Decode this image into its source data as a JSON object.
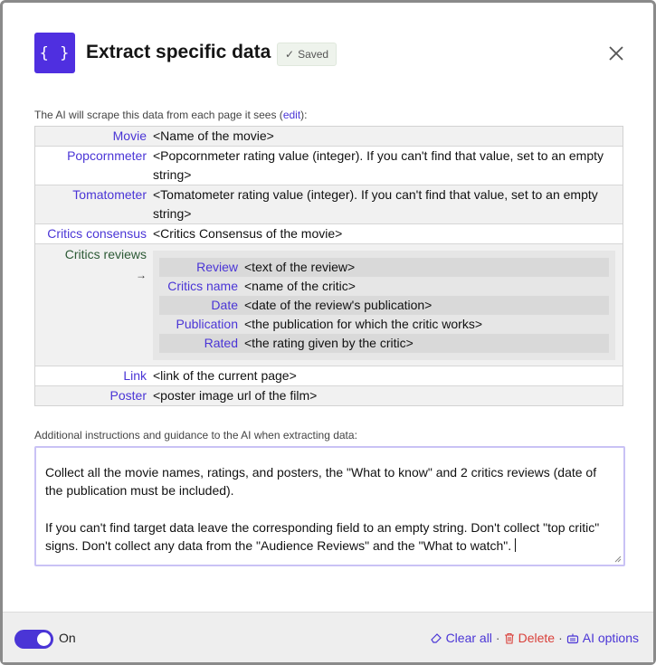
{
  "dialog": {
    "logo": "{ }",
    "title": "Extract specific data",
    "saved_label": "Saved"
  },
  "intro": {
    "prefix": "The AI will scrape this data from each page it sees (",
    "edit_link": "edit",
    "suffix": "):"
  },
  "schema": [
    {
      "key": "Movie",
      "value": "<Name of the movie>"
    },
    {
      "key": "Popcornmeter",
      "value": "<Popcornmeter rating value (integer). If you can't find that value, set to an empty string>"
    },
    {
      "key": "Tomatometer",
      "value": "<Tomatometer rating value (integer). If you can't find that value, set to an empty string>"
    },
    {
      "key": "Critics consensus",
      "value": "<Critics Consensus of the movie>"
    },
    {
      "key": "Critics reviews",
      "arrow": "→"
    },
    {
      "key": "Link",
      "value": "<link of the current page>"
    },
    {
      "key": "Poster",
      "value": "<poster image url of the film>"
    }
  ],
  "critics_reviews": [
    {
      "key": "Review",
      "value": "<text of the review>"
    },
    {
      "key": "Critics name",
      "value": "<name of the critic>"
    },
    {
      "key": "Date",
      "value": "<date of the review's publication>"
    },
    {
      "key": "Publication",
      "value": "<the publication for which the critic works>"
    },
    {
      "key": "Rated",
      "value": "<the rating given by the critic>"
    }
  ],
  "instructions": {
    "label": "Additional instructions and guidance to the AI when extracting data:",
    "paragraph1": "Collect all the movie names, ratings, and posters, the \"What to know\" and 2 critics reviews (date of the publication must be included).",
    "paragraph2": "If you can't find target data leave the corresponding field to an empty string. Don't collect \"top critic\" signs. Don't collect any data from the \"Audience Reviews\" and the \"What to watch\"."
  },
  "footer": {
    "toggle_label": "On",
    "clear_all": "Clear all",
    "delete": "Delete",
    "ai_options": "AI options",
    "separator": "·"
  },
  "colors": {
    "accent": "#4a35d6",
    "logo_bg": "#4f2fe0",
    "delete": "#d9403a"
  }
}
